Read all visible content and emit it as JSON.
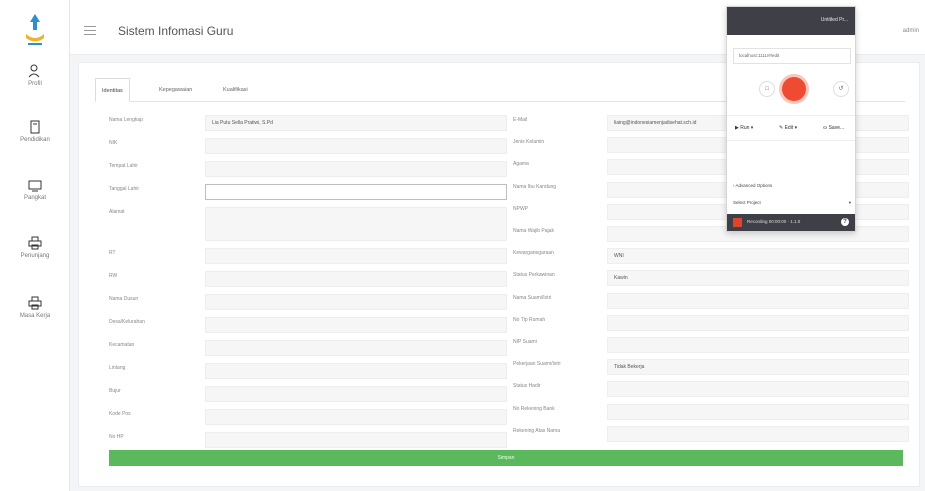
{
  "app": {
    "title": "Sistem Infomasi Guru",
    "user": "admin"
  },
  "sidebar": {
    "items": [
      {
        "label": "Profil",
        "icon": "user-icon"
      },
      {
        "label": "Pendidikan",
        "icon": "document-icon"
      },
      {
        "label": "Pangkat",
        "icon": "monitor-icon"
      },
      {
        "label": "Penunjang",
        "icon": "printer-icon"
      },
      {
        "label": "Masa Kerja",
        "icon": "printer-icon"
      }
    ]
  },
  "tabs": [
    "Identitas",
    "Kepegawaian",
    "Kualifikasi"
  ],
  "form": {
    "left": [
      {
        "label": "Nama Lengkap",
        "value": "Lia Putu Sella Pratiwi, S.Pd"
      },
      {
        "label": "NIK",
        "value": ""
      },
      {
        "label": "Tempat Lahir",
        "value": ""
      },
      {
        "label": "Tanggal Lahir",
        "value": ""
      },
      {
        "label": "Alamat",
        "value": ""
      },
      {
        "label": "RT",
        "value": ""
      },
      {
        "label": "RW",
        "value": ""
      },
      {
        "label": "Nama Dusun",
        "value": ""
      },
      {
        "label": "Desa/Kelurahan",
        "value": ""
      },
      {
        "label": "Kecamatan",
        "value": ""
      },
      {
        "label": "Lintang",
        "value": ""
      },
      {
        "label": "Bujur",
        "value": ""
      },
      {
        "label": "Kode Pos",
        "value": ""
      },
      {
        "label": "No HP",
        "value": ""
      }
    ],
    "right": [
      {
        "label": "E-Mail",
        "value": "liaing@indonesiamenjadisehat.sch.id"
      },
      {
        "label": "Jenis Kelamin",
        "value": ""
      },
      {
        "label": "Agama",
        "value": ""
      },
      {
        "label": "Nama Ibu Kandung",
        "value": ""
      },
      {
        "label": "NPWP",
        "value": ""
      },
      {
        "label": "Nama Wajib Pajak",
        "value": ""
      },
      {
        "label": "Kewarganegaraan",
        "value": "WNI"
      },
      {
        "label": "Status Perkawinan",
        "value": "Kawin"
      },
      {
        "label": "Nama Suami/Istri",
        "value": ""
      },
      {
        "label": "No Tlp Rumah",
        "value": ""
      },
      {
        "label": "NIP Suami",
        "value": ""
      },
      {
        "label": "Pekerjaan Suami/Istri",
        "value": "Tidak Bekerja"
      },
      {
        "label": "Status Hadir",
        "value": ""
      },
      {
        "label": "No Rekening Bank",
        "value": ""
      },
      {
        "label": "Rekening Atas Nama",
        "value": ""
      }
    ],
    "save_label": "Simpan"
  },
  "recorder": {
    "header_label": "Untitled Pr...",
    "url": "localhost:1111/#/edit",
    "toolbar": {
      "run": "Run",
      "edit": "Edit",
      "save": "Save..."
    },
    "advanced": "Advanced Options",
    "project_select": "Select Project",
    "footer": "Recording 00:00:00 · 1.1.0"
  },
  "colors": {
    "save_button": "#5cb85c",
    "record": "#ef4b32",
    "popup_header": "#3f4047"
  }
}
